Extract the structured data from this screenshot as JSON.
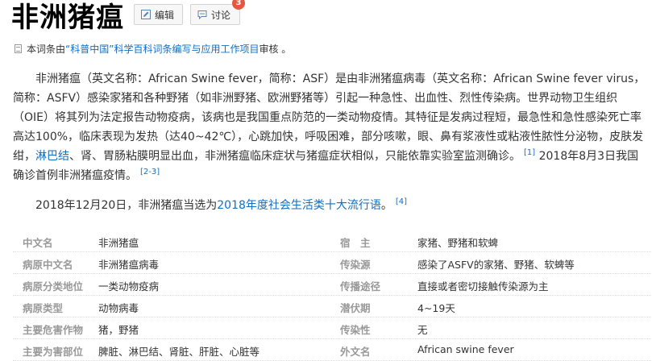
{
  "title": "非洲猪瘟",
  "buttons": {
    "edit_label": "编辑",
    "discuss_label": "讨论",
    "discuss_count": "3"
  },
  "review": {
    "prefix": "本词条由",
    "org": "“科普中国”科学百科词条编写与应用工作项目",
    "suffix": " 审核 。"
  },
  "intro": {
    "p1_text": "非洲猪瘟（英文名称：African Swine fever，简称：ASF）是由非洲猪瘟病毒（英文名称：African Swine fever virus，简称：ASFV）感染家猪和各种野猪（如非洲野猪、欧洲野猪等）引起一种急性、出血性、烈性传染病。世界动物卫生组织（OIE）将其列为法定报告动物疫病，该病也是我国重点防范的一类动物疫情。其特征是发病过程短，最急性和急性感染死亡率高达100%，临床表现为发热（达40~42℃），心跳加快，呼吸困难，部分咳嗽，眼、鼻有浆液性或粘液性脓性分泌物，皮肤发绀，",
    "p1_link": "淋巴结",
    "p1_text2": "、肾、胃肠粘膜明显出血，非洲猪瘟临床症状与猪瘟症状相似，只能依靠实验室监测确诊。",
    "p1_ref1": "[1]",
    "p1_text3": " 2018年8月3日我国确诊首例非洲猪瘟疫情。",
    "p1_ref2": "[2-3]",
    "p2_text": "2018年12月20日，非洲猪瘟当选为",
    "p2_link": "2018年度社会生活类十大流行语",
    "p2_text2": "。",
    "p2_ref": "[4]"
  },
  "infobox": {
    "rows": [
      {
        "k1": "中文名",
        "v1": "非洲猪瘟",
        "k2": "宿　主",
        "v2": "家猪、野猪和软蜱"
      },
      {
        "k1": "病原中文名",
        "v1": "非洲猪瘟病毒",
        "k2": "传染源",
        "v2": "感染了ASFV的家猪、野猪、软蜱等"
      },
      {
        "k1": "病原分类地位",
        "v1": "一类动物疫病",
        "k2": "传播途径",
        "v2": "直接或者密切接触传染源为主"
      },
      {
        "k1": "病原类型",
        "v1": "动物病毒",
        "k2": "潜伏期",
        "v2": "4~19天"
      },
      {
        "k1": "主要危害作物",
        "v1": "猪，野猪",
        "k2": "传染性",
        "v2": "无"
      },
      {
        "k1": "主要为害部位",
        "v1": "脾脏、淋巴结、肾脏、肝脏、心脏等",
        "k2": "外文名",
        "v2": "African swine fever"
      }
    ]
  }
}
